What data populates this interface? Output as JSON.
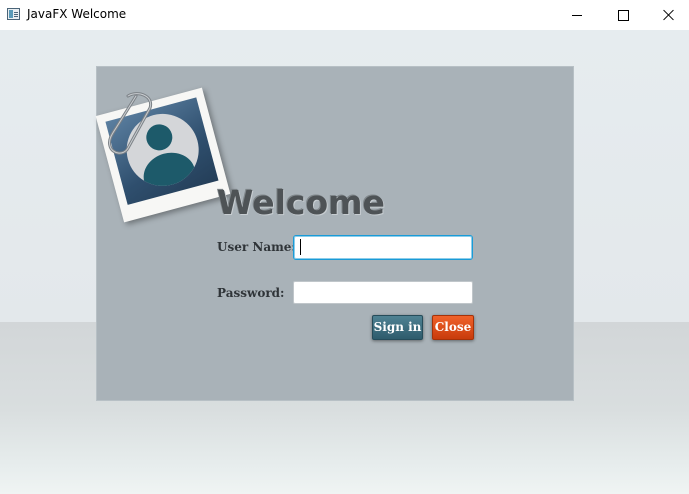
{
  "window": {
    "title": "JavaFX Welcome",
    "icon": "javafx-window-icon"
  },
  "controls": {
    "minimize_icon": "minimize-icon",
    "maximize_icon": "maximize-icon",
    "close_icon": "close-icon"
  },
  "form": {
    "heading": "Welcome",
    "username_label": "User Name:",
    "username_value": "",
    "password_label": "Password:",
    "password_value": "",
    "signin_label": "Sign in",
    "close_label": "Close"
  },
  "colors": {
    "panel": "#a9b2b8",
    "signin": "#3d6d7e",
    "close": "#e04a15",
    "focus": "#1a9bd7"
  }
}
